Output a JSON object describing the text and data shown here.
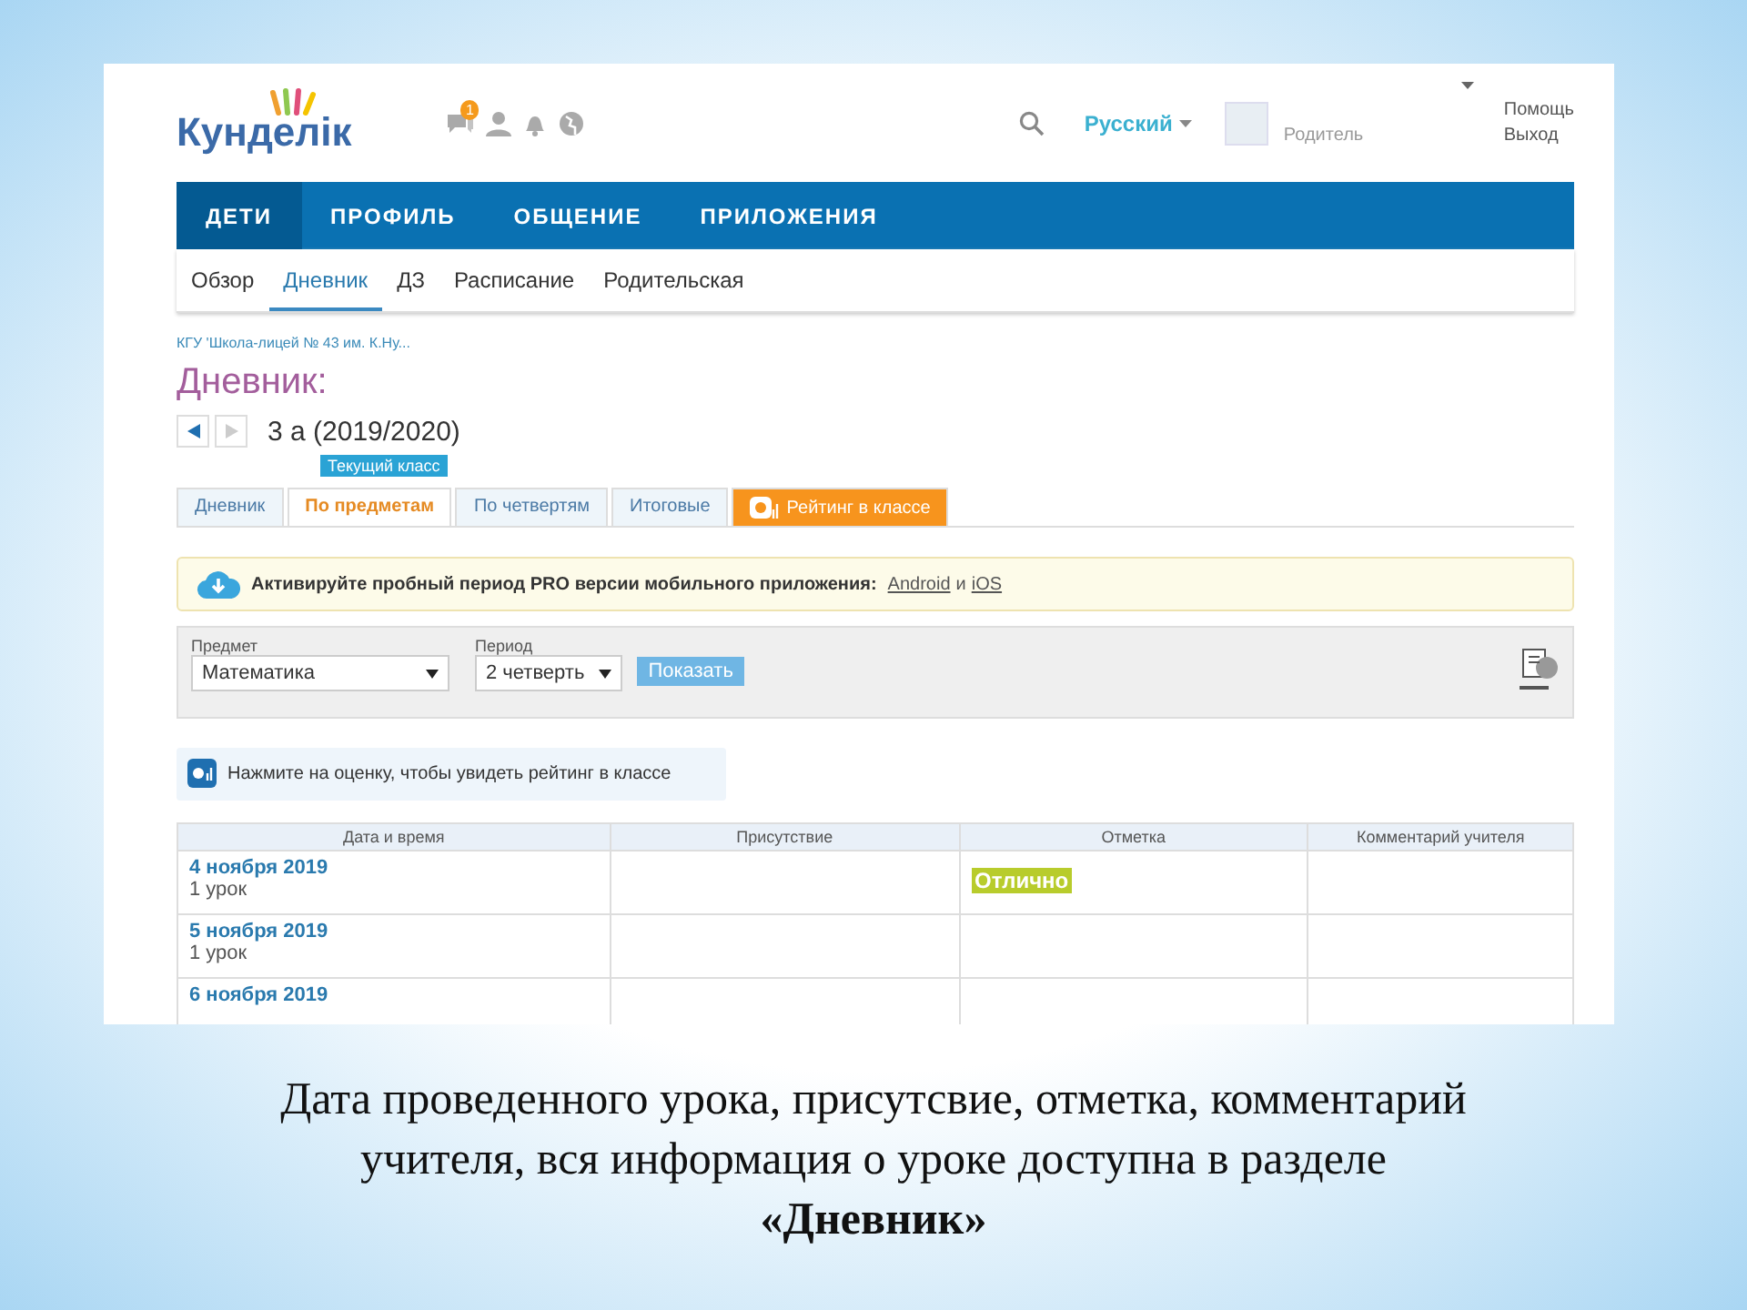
{
  "header": {
    "logo": "Кунделік",
    "notification_count": "1",
    "language": "Русский",
    "user_role": "Родитель",
    "links": [
      "Помощь",
      "Выход"
    ]
  },
  "main_nav": [
    {
      "label": "ДЕТИ",
      "selected": true
    },
    {
      "label": "ПРОФИЛЬ",
      "selected": false
    },
    {
      "label": "ОБЩЕНИЕ",
      "selected": false
    },
    {
      "label": "ПРИЛОЖЕНИЯ",
      "selected": false
    }
  ],
  "sub_nav": [
    {
      "label": "Обзор",
      "selected": false
    },
    {
      "label": "Дневник",
      "selected": true
    },
    {
      "label": "ДЗ",
      "selected": false
    },
    {
      "label": "Расписание",
      "selected": false
    },
    {
      "label": "Родительская",
      "selected": false
    }
  ],
  "breadcrumb": "КГУ 'Школа-лицей № 43 им. К.Ну...",
  "page_title": "Дневник:",
  "class_name": "3 а (2019/2020)",
  "class_badge": "Текущий класс",
  "tabs": [
    {
      "label": "Дневник",
      "selected": false,
      "kind": "plain"
    },
    {
      "label": "По предметам",
      "selected": true,
      "kind": "plain"
    },
    {
      "label": "По четвертям",
      "selected": false,
      "kind": "plain"
    },
    {
      "label": "Итоговые",
      "selected": false,
      "kind": "plain"
    },
    {
      "label": "Рейтинг в классе",
      "selected": false,
      "kind": "rating"
    }
  ],
  "promo": {
    "text": "Активируйте пробный период PRO версии мобильного приложения:",
    "links": [
      "Android",
      "iOS"
    ],
    "joiner": "и"
  },
  "filters": {
    "subject_label": "Предмет",
    "subject_value": "Математика",
    "period_label": "Период",
    "period_value": "2 четверть",
    "button": "Показать"
  },
  "rating_hint": "Нажмите на оценку, чтобы увидеть рейтинг в классе",
  "table": {
    "columns": [
      "Дата и время",
      "Присутствие",
      "Отметка",
      "Комментарий учителя"
    ],
    "rows": [
      {
        "date": "4 ноября 2019",
        "lesson": "1 урок",
        "mark": "Отлично"
      },
      {
        "date": "5 ноября 2019",
        "lesson": "1 урок"
      },
      {
        "date": "6 ноября 2019"
      }
    ]
  },
  "caption": {
    "lines": [
      "Дата проведенного урока, присутсвие, отметка, комментарий",
      "учителя, вся информация о уроке доступна в разделе"
    ],
    "emphasis": "«Дневник»"
  }
}
